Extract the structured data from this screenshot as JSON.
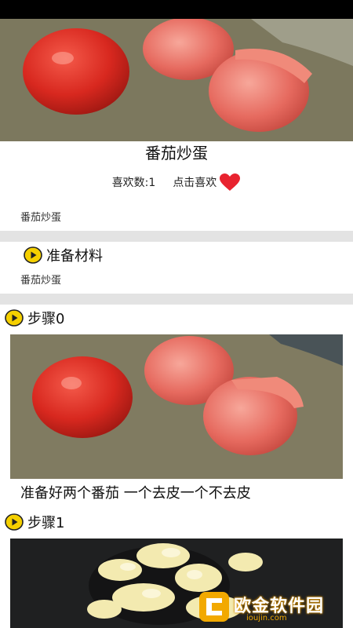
{
  "recipe": {
    "title": "番茄炒蛋",
    "likes_label": "喜欢数:1",
    "like_button_label": "点击喜欢",
    "description": "番茄炒蛋"
  },
  "ingredients": {
    "heading": "准备材料",
    "text": "番茄炒蛋"
  },
  "steps": [
    {
      "heading": "步骤0",
      "text": "准备好两个番茄 一个去皮一个不去皮"
    },
    {
      "heading": "步骤1",
      "text": ""
    }
  ],
  "watermark": {
    "brand": "欧金软件园",
    "domain": "ioujin.com"
  },
  "colors": {
    "accent_yellow": "#f5d000",
    "heart_red": "#e8232f",
    "divider": "#e3e3e3"
  },
  "icons": [
    "play-circle-icon",
    "heart-icon"
  ]
}
